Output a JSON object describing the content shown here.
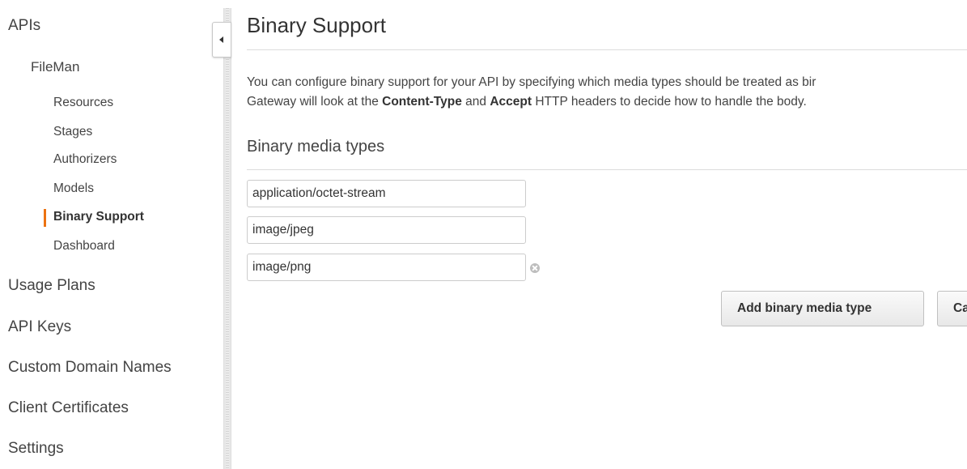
{
  "sidebar": {
    "apis": "APIs",
    "api_name": "FileMan",
    "sub_items": [
      {
        "label": "Resources"
      },
      {
        "label": "Stages"
      },
      {
        "label": "Authorizers"
      },
      {
        "label": "Models"
      },
      {
        "label": "Binary Support"
      },
      {
        "label": "Dashboard"
      }
    ],
    "active_item": "Binary Support",
    "active_color": "#ec7211",
    "bottom_items": [
      {
        "label": "Usage Plans"
      },
      {
        "label": "API Keys"
      },
      {
        "label": "Custom Domain Names"
      },
      {
        "label": "Client Certificates"
      },
      {
        "label": "Settings"
      }
    ]
  },
  "collapse_icon": "chevron-left-icon",
  "main": {
    "title": "Binary Support",
    "description": {
      "line1": "You can configure binary support for your API by specifying which media types should be treated as bir",
      "line2_pre": "Gateway will look at the ",
      "line2_header1": "Content-Type",
      "line2_mid": " and ",
      "line2_header2": "Accept",
      "line2_post": " HTTP headers to decide how to handle the body."
    },
    "section_title": "Binary media types",
    "media_types": [
      {
        "value": "application/octet-stream"
      },
      {
        "value": "image/jpeg"
      },
      {
        "value": "image/png"
      }
    ],
    "remove_icon": "remove-circle-icon",
    "buttons": {
      "add_label": "Add binary media type",
      "cancel_label": "Ca"
    }
  }
}
